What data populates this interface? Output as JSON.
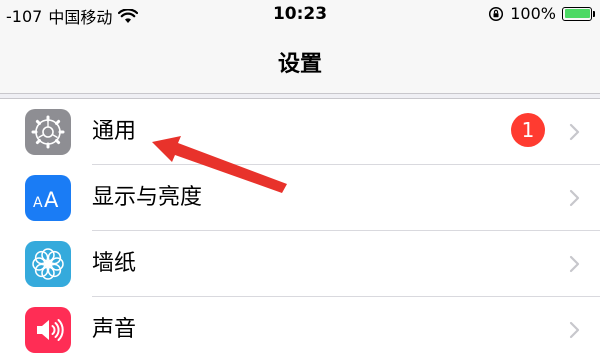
{
  "status_bar": {
    "signal": "-107",
    "carrier": "中国移动",
    "time": "10:23",
    "battery_percent": "100%",
    "battery_level": 1.0,
    "icons": [
      "wifi-icon",
      "orientation-lock-icon",
      "battery-icon"
    ]
  },
  "nav": {
    "title": "设置"
  },
  "settings": {
    "items": [
      {
        "label": "通用",
        "icon": "gear-icon",
        "icon_color": "#8e8e93",
        "badge": "1"
      },
      {
        "label": "显示与亮度",
        "icon": "display-brightness-icon",
        "icon_color": "#1a7cf5"
      },
      {
        "label": "墙纸",
        "icon": "wallpaper-flower-icon",
        "icon_color": "#35aadc"
      },
      {
        "label": "声音",
        "icon": "speaker-icon",
        "icon_color": "#ff2d55"
      }
    ]
  },
  "colors": {
    "badge": "#ff3b30",
    "annotation_arrow": "#e8322b",
    "battery_fill": "#4cd964"
  }
}
